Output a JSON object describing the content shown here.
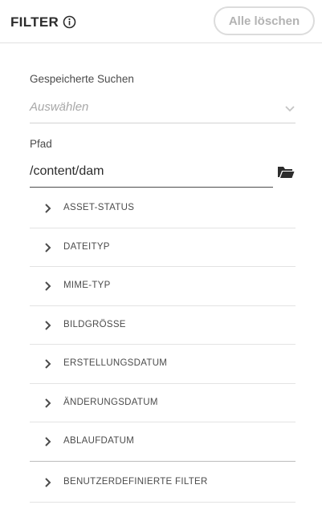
{
  "header": {
    "title": "FILTER",
    "clear_button": "Alle löschen"
  },
  "saved_searches": {
    "label": "Gespeicherte Suchen",
    "placeholder": "Auswählen"
  },
  "path": {
    "label": "Pfad",
    "value": "/content/dam"
  },
  "filters": [
    {
      "label": "ASSET-STATUS"
    },
    {
      "label": "DATEITYP"
    },
    {
      "label": "MIME-TYP"
    },
    {
      "label": "BILDGRÖSSE"
    },
    {
      "label": "ERSTELLUNGSDATUM"
    },
    {
      "label": "ÄNDERUNGSDATUM"
    },
    {
      "label": "ABLAUFDATUM"
    },
    {
      "label": "BENUTZERDEFINIERTE FILTER"
    }
  ]
}
